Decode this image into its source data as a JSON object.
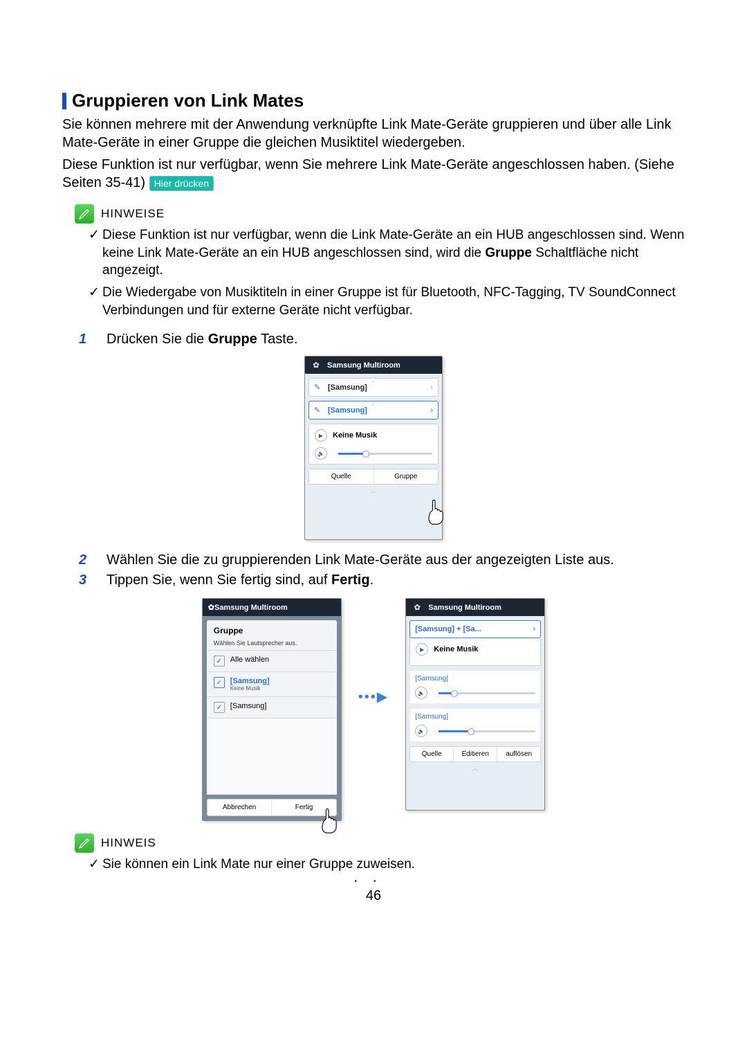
{
  "section": {
    "title": "Gruppieren von Link Mates",
    "p1": "Sie können mehrere mit der Anwendung verknüpfte Link Mate-Geräte gruppieren und über alle Link Mate-Geräte in einer Gruppe die gleichen Musiktitel wiedergeben.",
    "p2a": "Diese Funktion ist nur verfügbar, wenn Sie mehrere Link Mate-Geräte angeschlossen haben. (Siehe Seiten 35-41) ",
    "click_here": "Hier drücken"
  },
  "notes1": {
    "label": "HINWEISE",
    "items": [
      "Diese Funktion ist nur verfügbar, wenn die Link Mate-Geräte an ein HUB angeschlossen sind. Wenn keine Link Mate-Geräte an ein HUB angeschlossen sind, wird die Gruppe Schaltfläche nicht angezeigt.",
      "Die Wiedergabe von Musiktiteln in einer Gruppe ist für Bluetooth, NFC-Tagging, TV SoundConnect Verbindungen und für externe Geräte nicht verfügbar."
    ],
    "bold_in_item0": "Gruppe"
  },
  "steps": {
    "s1_pre": "Drücken Sie die ",
    "s1_bold": "Gruppe",
    "s1_post": " Taste.",
    "s2": "Wählen Sie die zu gruppierenden Link Mate-Geräte aus der angezeigten Liste aus.",
    "s3_pre": "Tippen Sie, wenn Sie fertig sind, auf ",
    "s3_bold": "Fertig",
    "s3_post": "."
  },
  "notes2": {
    "label": "HINWEIS",
    "item": "Sie können ein Link Mate nur einer Gruppe zuweisen."
  },
  "page_number": "46",
  "mock1": {
    "title": "Samsung Multiroom",
    "speaker1": "[Samsung]",
    "speaker2": "[Samsung]",
    "nowplay": "Keine Musik",
    "btn_source": "Quelle",
    "btn_group": "Gruppe"
  },
  "mock_sel": {
    "title": "Samsung Multiroom",
    "dlg_title": "Gruppe",
    "dlg_sub": "Wählen Sie Lautsprecher aus.",
    "opt_all": "Alle wählen",
    "opt_s1": "[Samsung]",
    "opt_s1_sub": "Keine Musik",
    "opt_s2": "[Samsung]",
    "btn_cancel": "Abbrechen",
    "btn_done": "Fertig"
  },
  "mock_grouped": {
    "title": "Samsung Multiroom",
    "group_label": "[Samsung] + [Sa...",
    "nowplay": "Keine Musik",
    "spk1": "[Samsung]",
    "spk2": "[Samsung]",
    "btn_source": "Quelle",
    "btn_edit": "Editieren",
    "btn_dissolve": "auflösen"
  }
}
